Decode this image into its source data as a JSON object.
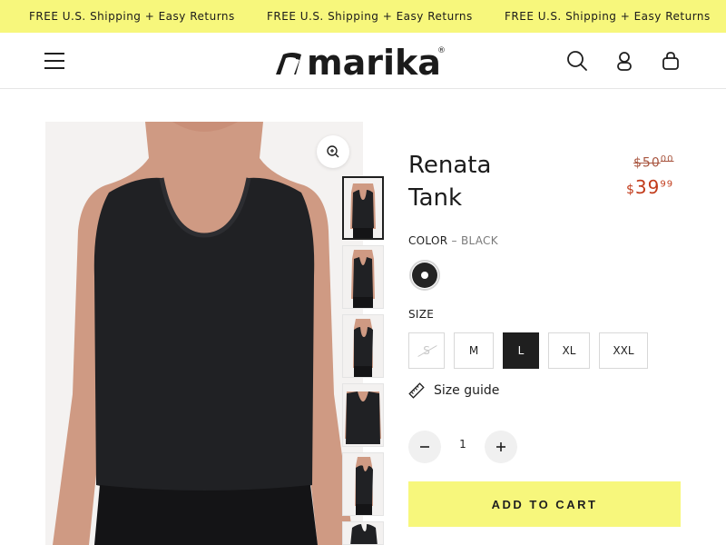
{
  "announcement": {
    "messages": [
      "FREE U.S. Shipping + Easy Returns",
      "FREE U.S. Shipping + Easy Returns",
      "FREE U.S. Shipping + Easy Returns"
    ],
    "background": "#f7f77c"
  },
  "header": {
    "logo_text": "marika",
    "icons": [
      "menu-icon",
      "search-icon",
      "account-icon",
      "cart-icon"
    ]
  },
  "gallery": {
    "thumbnail_count": 6,
    "active_thumbnail": 1,
    "zoom_icon": "zoom-in-icon"
  },
  "product": {
    "title": "Renata Tank",
    "price_old_currency": "$",
    "price_old_whole": "50",
    "price_old_cents": "00",
    "price_new_currency": "$",
    "price_new_whole": "39",
    "price_new_cents": "99",
    "sale_color": "#c23c1c",
    "color_label": "COLOR",
    "color_selected": "BLACK",
    "color_separator": "–",
    "swatch_color": "#242424",
    "size_label": "SIZE",
    "sizes": [
      {
        "label": "S",
        "state": "disabled"
      },
      {
        "label": "M",
        "state": "available"
      },
      {
        "label": "L",
        "state": "selected"
      },
      {
        "label": "XL",
        "state": "available"
      },
      {
        "label": "XXL",
        "state": "available"
      }
    ],
    "size_guide_label": "Size guide",
    "quantity": "1",
    "add_to_cart_label": "ADD TO CART"
  }
}
